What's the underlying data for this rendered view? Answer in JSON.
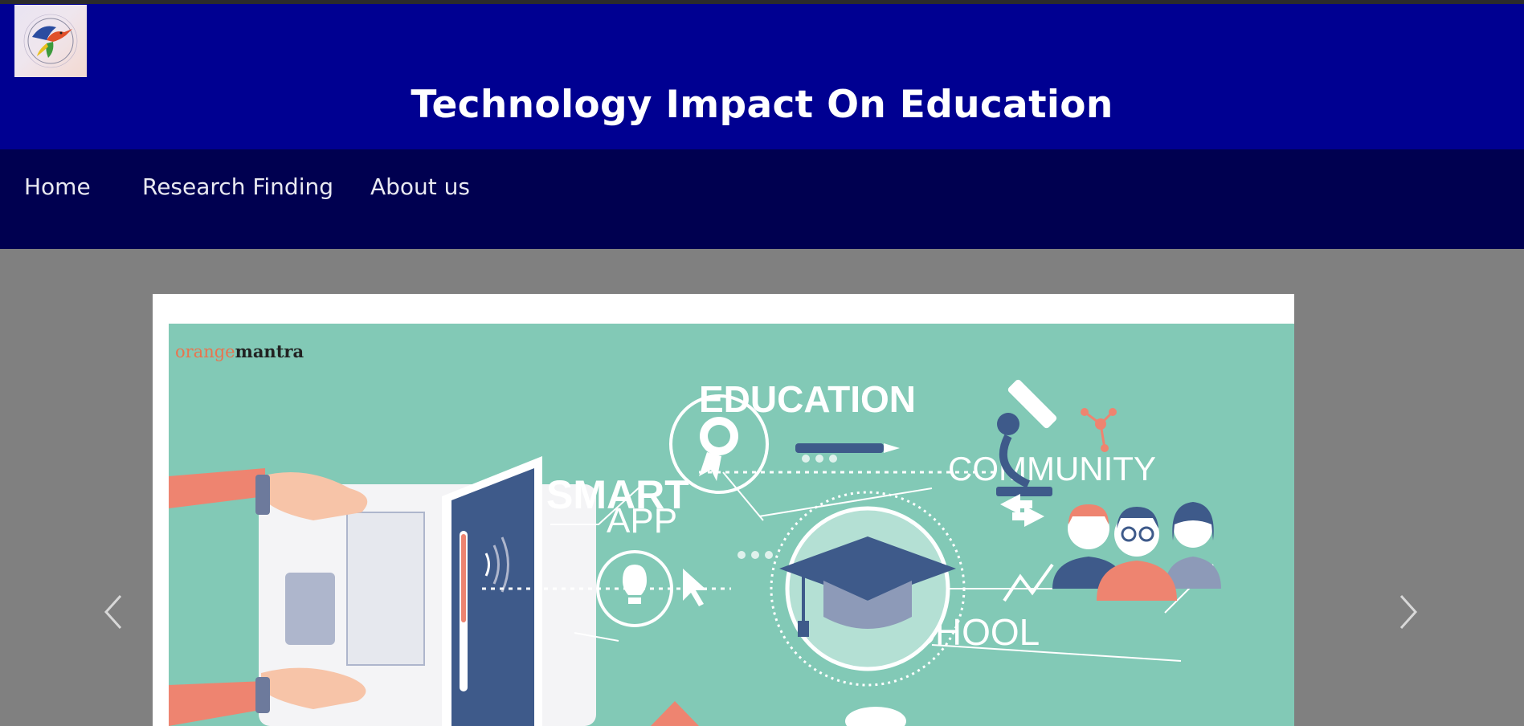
{
  "header": {
    "title": "Technology Impact On Education",
    "logo_icon": "hummingbird-logo-icon",
    "background_color": "#000091"
  },
  "nav": {
    "background_color": "#000050",
    "items": [
      {
        "label": "Home"
      },
      {
        "label": "Research Finding"
      },
      {
        "label": "About us"
      }
    ]
  },
  "carousel": {
    "prev_icon": "chevron-left-icon",
    "next_icon": "chevron-right-icon",
    "slide": {
      "brand_left": "orange",
      "brand_right": "mantra",
      "words": {
        "education": "EDUCATION",
        "smart": "SMART",
        "app": "APP",
        "community": "COMMUNITY",
        "school": "SCHOOL"
      },
      "background_color": "#82c9b6"
    }
  }
}
